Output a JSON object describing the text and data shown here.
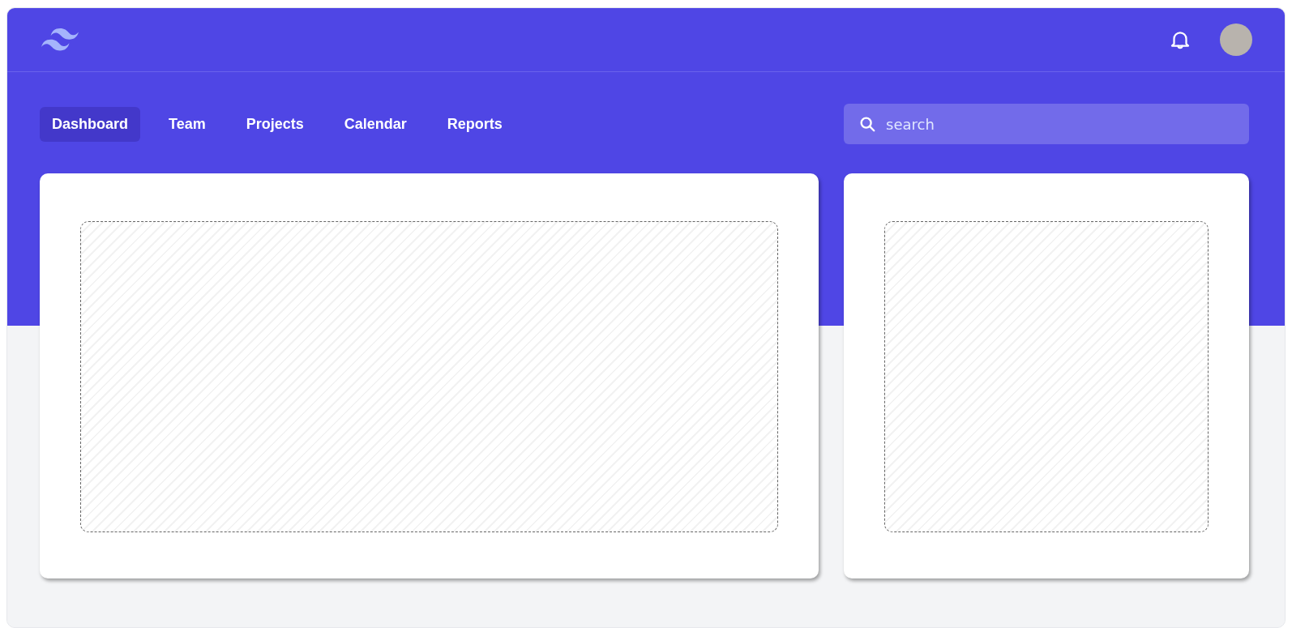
{
  "nav": [
    {
      "label": "Dashboard",
      "selected": true
    },
    {
      "label": "Team",
      "selected": false
    },
    {
      "label": "Projects",
      "selected": false
    },
    {
      "label": "Calendar",
      "selected": false
    },
    {
      "label": "Reports",
      "selected": false
    }
  ],
  "search": {
    "placeholder": "search"
  }
}
